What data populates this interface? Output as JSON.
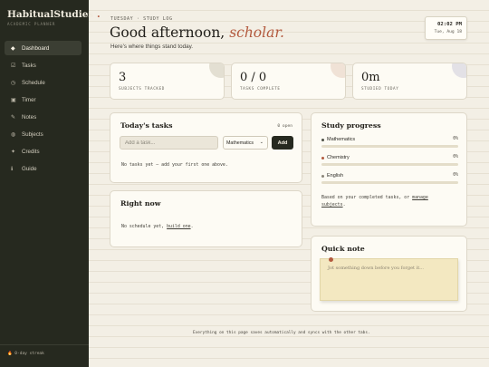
{
  "brand": {
    "name": "HabitualStudies",
    "dot": ".",
    "tagline": "ACADEMIC PLANNER"
  },
  "sidebar": {
    "items": [
      {
        "label": "Dashboard",
        "icon": "◆",
        "icon_name": "dashboard-icon",
        "active": true
      },
      {
        "label": "Tasks",
        "icon": "☑",
        "icon_name": "tasks-icon"
      },
      {
        "label": "Schedule",
        "icon": "◷",
        "icon_name": "clock-icon"
      },
      {
        "label": "Timer",
        "icon": "▣",
        "icon_name": "timer-icon"
      },
      {
        "label": "Notes",
        "icon": "✎",
        "icon_name": "pencil-icon"
      },
      {
        "label": "Subjects",
        "icon": "◍",
        "icon_name": "subjects-icon"
      },
      {
        "label": "Credits",
        "icon": "✦",
        "icon_name": "star-icon"
      },
      {
        "label": "Guide",
        "icon": "ℹ",
        "icon_name": "info-icon"
      }
    ],
    "streak": "🔥 0-day streak"
  },
  "header": {
    "eyebrow": "TUESDAY · STUDY LOG",
    "greeting_prefix": "Good afternoon,",
    "greeting_name": "scholar.",
    "subtitle": "Here's where things stand today."
  },
  "clock": {
    "time": "02:02 PM",
    "date": "Tue, Aug 18"
  },
  "stats": [
    {
      "value": "3",
      "label": "SUBJECTS TRACKED",
      "deco_color": "#e3dfd2"
    },
    {
      "value": "0 / 0",
      "label": "TASKS COMPLETE",
      "deco_color": "#f0e2d6"
    },
    {
      "value": "0m",
      "label": "STUDIED TODAY",
      "deco_color": "#e3e1e6"
    }
  ],
  "tasks": {
    "title": "Today's tasks",
    "open_count": "0 open",
    "input_placeholder": "Add a task...",
    "selected_subject": "Mathematics",
    "add_label": "Add",
    "empty_text": "No tasks yet — add your first one above."
  },
  "right_now": {
    "title": "Right now",
    "empty_prefix": "No schedule yet,",
    "link": "build one",
    "suffix": "."
  },
  "progress": {
    "title": "Study progress",
    "subjects": [
      {
        "name": "Mathematics",
        "percent_label": "0%",
        "fraction": 0,
        "color": "#4c4f45"
      },
      {
        "name": "Chemistry",
        "percent_label": "0%",
        "fraction": 0,
        "color": "#b35a3e"
      },
      {
        "name": "English",
        "percent_label": "0%",
        "fraction": 0,
        "color": "#8a8478"
      }
    ],
    "note_line1": "Based on your completed tasks, or",
    "note_link1": "manage",
    "note_link2": "subjects",
    "note_end": "."
  },
  "quick_note": {
    "title": "Quick note",
    "placeholder": "Jot something down before you forget it..."
  },
  "footer": "Everything on this page saves automatically and syncs with the other tabs."
}
